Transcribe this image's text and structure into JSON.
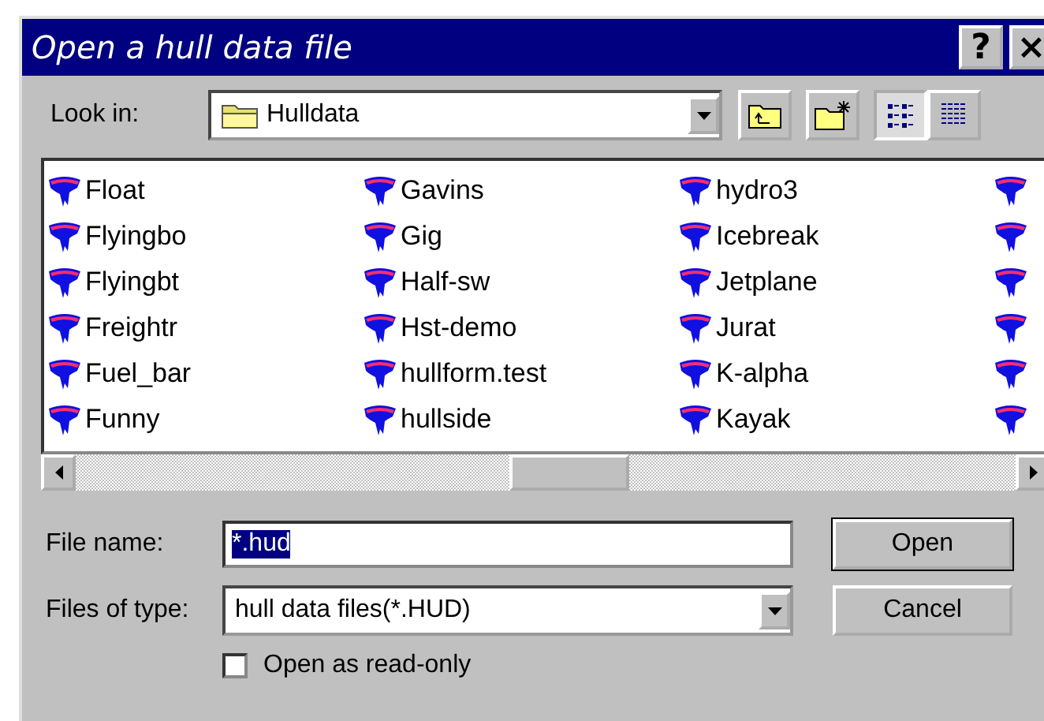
{
  "window": {
    "title": "Open a hull data file",
    "buttons": [
      "?",
      "×"
    ]
  },
  "look_in": {
    "label": "Look in:",
    "value": "Hulldata"
  },
  "view_modes": [
    {
      "kind": "list",
      "selected": true
    },
    {
      "kind": "details",
      "selected": false
    }
  ],
  "files": [
    {
      "kind": "file",
      "name": "Float"
    },
    {
      "kind": "file",
      "name": "Flyingbo"
    },
    {
      "kind": "file",
      "name": "Flyingbt"
    },
    {
      "kind": "file",
      "name": "Freightr"
    },
    {
      "kind": "file",
      "name": "Fuel_bar"
    },
    {
      "kind": "file",
      "name": "Funny"
    },
    {
      "kind": "file",
      "name": "Gavins"
    },
    {
      "kind": "file",
      "name": "Gig"
    },
    {
      "kind": "file",
      "name": "Half-sw"
    },
    {
      "kind": "file",
      "name": "Hst-demo"
    },
    {
      "kind": "file",
      "name": "hullform.test"
    },
    {
      "kind": "file",
      "name": "hullside"
    },
    {
      "kind": "file",
      "name": "hydro3"
    },
    {
      "kind": "file",
      "name": "Icebreak"
    },
    {
      "kind": "file",
      "name": "Jetplane"
    },
    {
      "kind": "file",
      "name": "Jurat"
    },
    {
      "kind": "file",
      "name": "K-alpha"
    },
    {
      "kind": "file",
      "name": "Kayak"
    },
    {
      "kind": "clipped"
    },
    {
      "kind": "clipped"
    },
    {
      "kind": "clipped"
    },
    {
      "kind": "clipped"
    },
    {
      "kind": "clipped"
    },
    {
      "kind": "clipped"
    }
  ],
  "file_name": {
    "label": "File name:",
    "value": "*.hud",
    "selected": true
  },
  "file_type": {
    "label": "Files of type:",
    "value": "hull data files(*.HUD)"
  },
  "read_only": {
    "label": "Open as read-only",
    "checked": false
  },
  "buttons": [
    {
      "label": "Open",
      "default": true
    },
    {
      "label": "Cancel",
      "default": false
    }
  ]
}
